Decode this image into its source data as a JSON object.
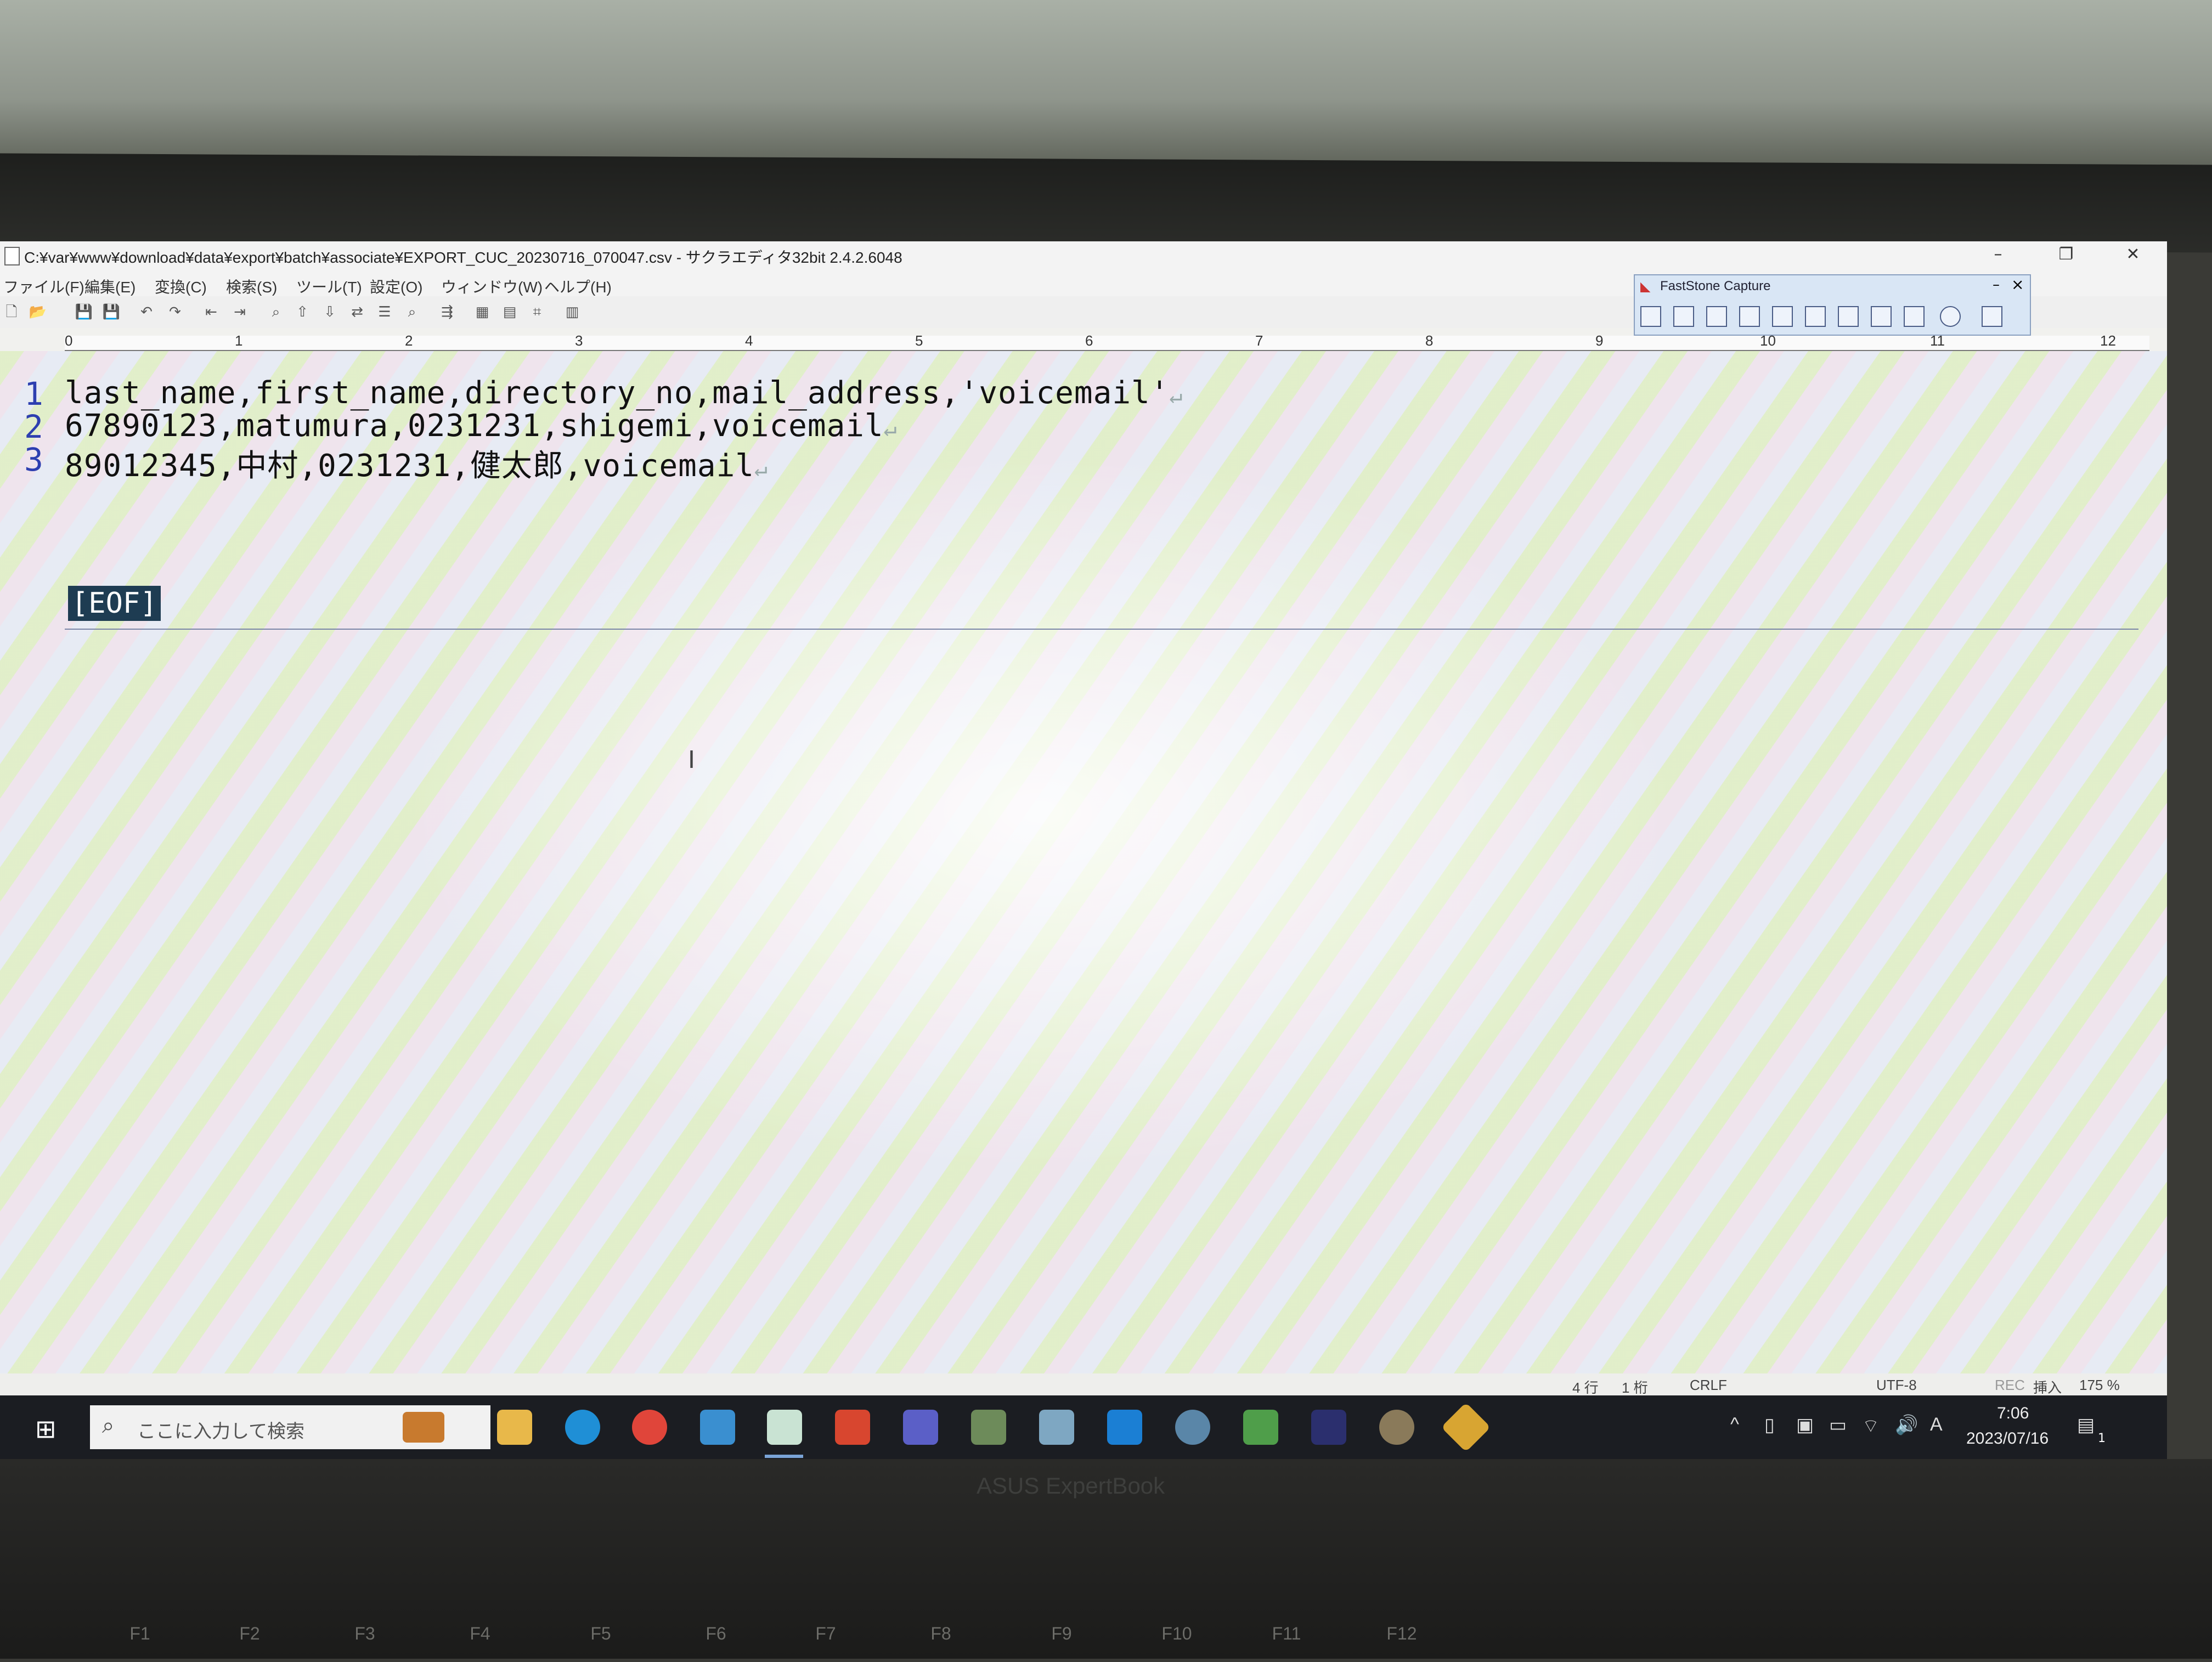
{
  "window": {
    "title": "C:¥var¥www¥download¥data¥export¥batch¥associate¥EXPORT_CUC_20230716_070047.csv - サクラエディタ32bit 2.4.2.6048",
    "minimize_icon": "minimize-icon",
    "restore_icon": "restore-icon",
    "close_icon": "close-icon"
  },
  "menu": [
    "ファイル(F)",
    "編集(E)",
    "変換(C)",
    "検索(S)",
    "ツール(T)",
    "設定(O)",
    "ウィンドウ(W)",
    "ヘルプ(H)"
  ],
  "ruler": [
    "0",
    "1",
    "2",
    "3",
    "4",
    "5",
    "6",
    "7",
    "8",
    "9",
    "10",
    "11",
    "12"
  ],
  "editor": {
    "line_numbers": [
      "1",
      "2",
      "3"
    ],
    "lines": [
      "last_name,first_name,directory_no,mail_address,'voicemail'",
      "67890123,matumura,0231231,shigemi,voicemail",
      "89012345,中村,0231231,健太郎,voicemail"
    ],
    "line_end_mark": "↵",
    "eof": "[EOF]"
  },
  "faststone": {
    "title": "FastStone Capture",
    "minimize": "–",
    "close": "×"
  },
  "status": {
    "row": "4 行",
    "col": "1 桁",
    "eol": "CRLF",
    "encoding": "UTF-8",
    "rec": "REC",
    "mode": "挿入",
    "zoom": "175 %"
  },
  "taskbar": {
    "search_placeholder": "ここに入力して検索",
    "time": "7:06",
    "date": "2023/07/16",
    "ime": "A",
    "notification_count": "1"
  },
  "hardware": {
    "brand": "ASUS ExpertBook",
    "fkeys": [
      "F1",
      "F2",
      "F3",
      "F4",
      "F5",
      "F6",
      "F7",
      "F8",
      "F9",
      "F10",
      "F11",
      "F12"
    ]
  }
}
